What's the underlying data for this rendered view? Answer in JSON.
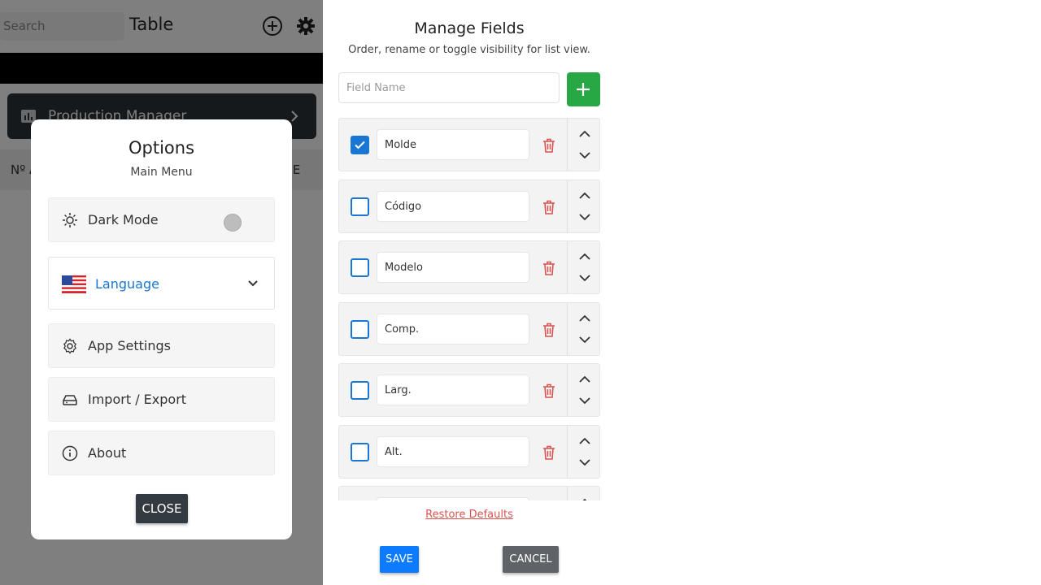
{
  "app": {
    "search_placeholder": "Search",
    "title": "Table",
    "add_icon": "plus-circle-icon",
    "settings_icon": "gear-icon",
    "card_title": "Production Manager",
    "table_col_left": "Nº A",
    "table_col_right": "LDE"
  },
  "options": {
    "title": "Options",
    "subtitle": "Main Menu",
    "dark_mode_label": "Dark Mode",
    "language_label": "Language",
    "app_settings_label": "App Settings",
    "import_export_label": "Import / Export",
    "about_label": "About",
    "close_label": "CLOSE"
  },
  "manage": {
    "title": "Manage Fields",
    "subtitle": "Order, rename or toggle visibility for list view.",
    "field_name_placeholder": "Field Name",
    "fields": [
      {
        "name": "Molde",
        "checked": true
      },
      {
        "name": "Código",
        "checked": false
      },
      {
        "name": "Modelo",
        "checked": false
      },
      {
        "name": "Comp.",
        "checked": false
      },
      {
        "name": "Larg.",
        "checked": false
      },
      {
        "name": "Alt.",
        "checked": false
      },
      {
        "name": "",
        "checked": false
      }
    ],
    "restore_label": "Restore Defaults",
    "save_label": "SAVE",
    "cancel_label": "CANCEL"
  },
  "colors": {
    "accent": "#1976d2",
    "add_green": "#28a745",
    "danger": "#d9534f",
    "save_blue": "#0d7bff"
  }
}
